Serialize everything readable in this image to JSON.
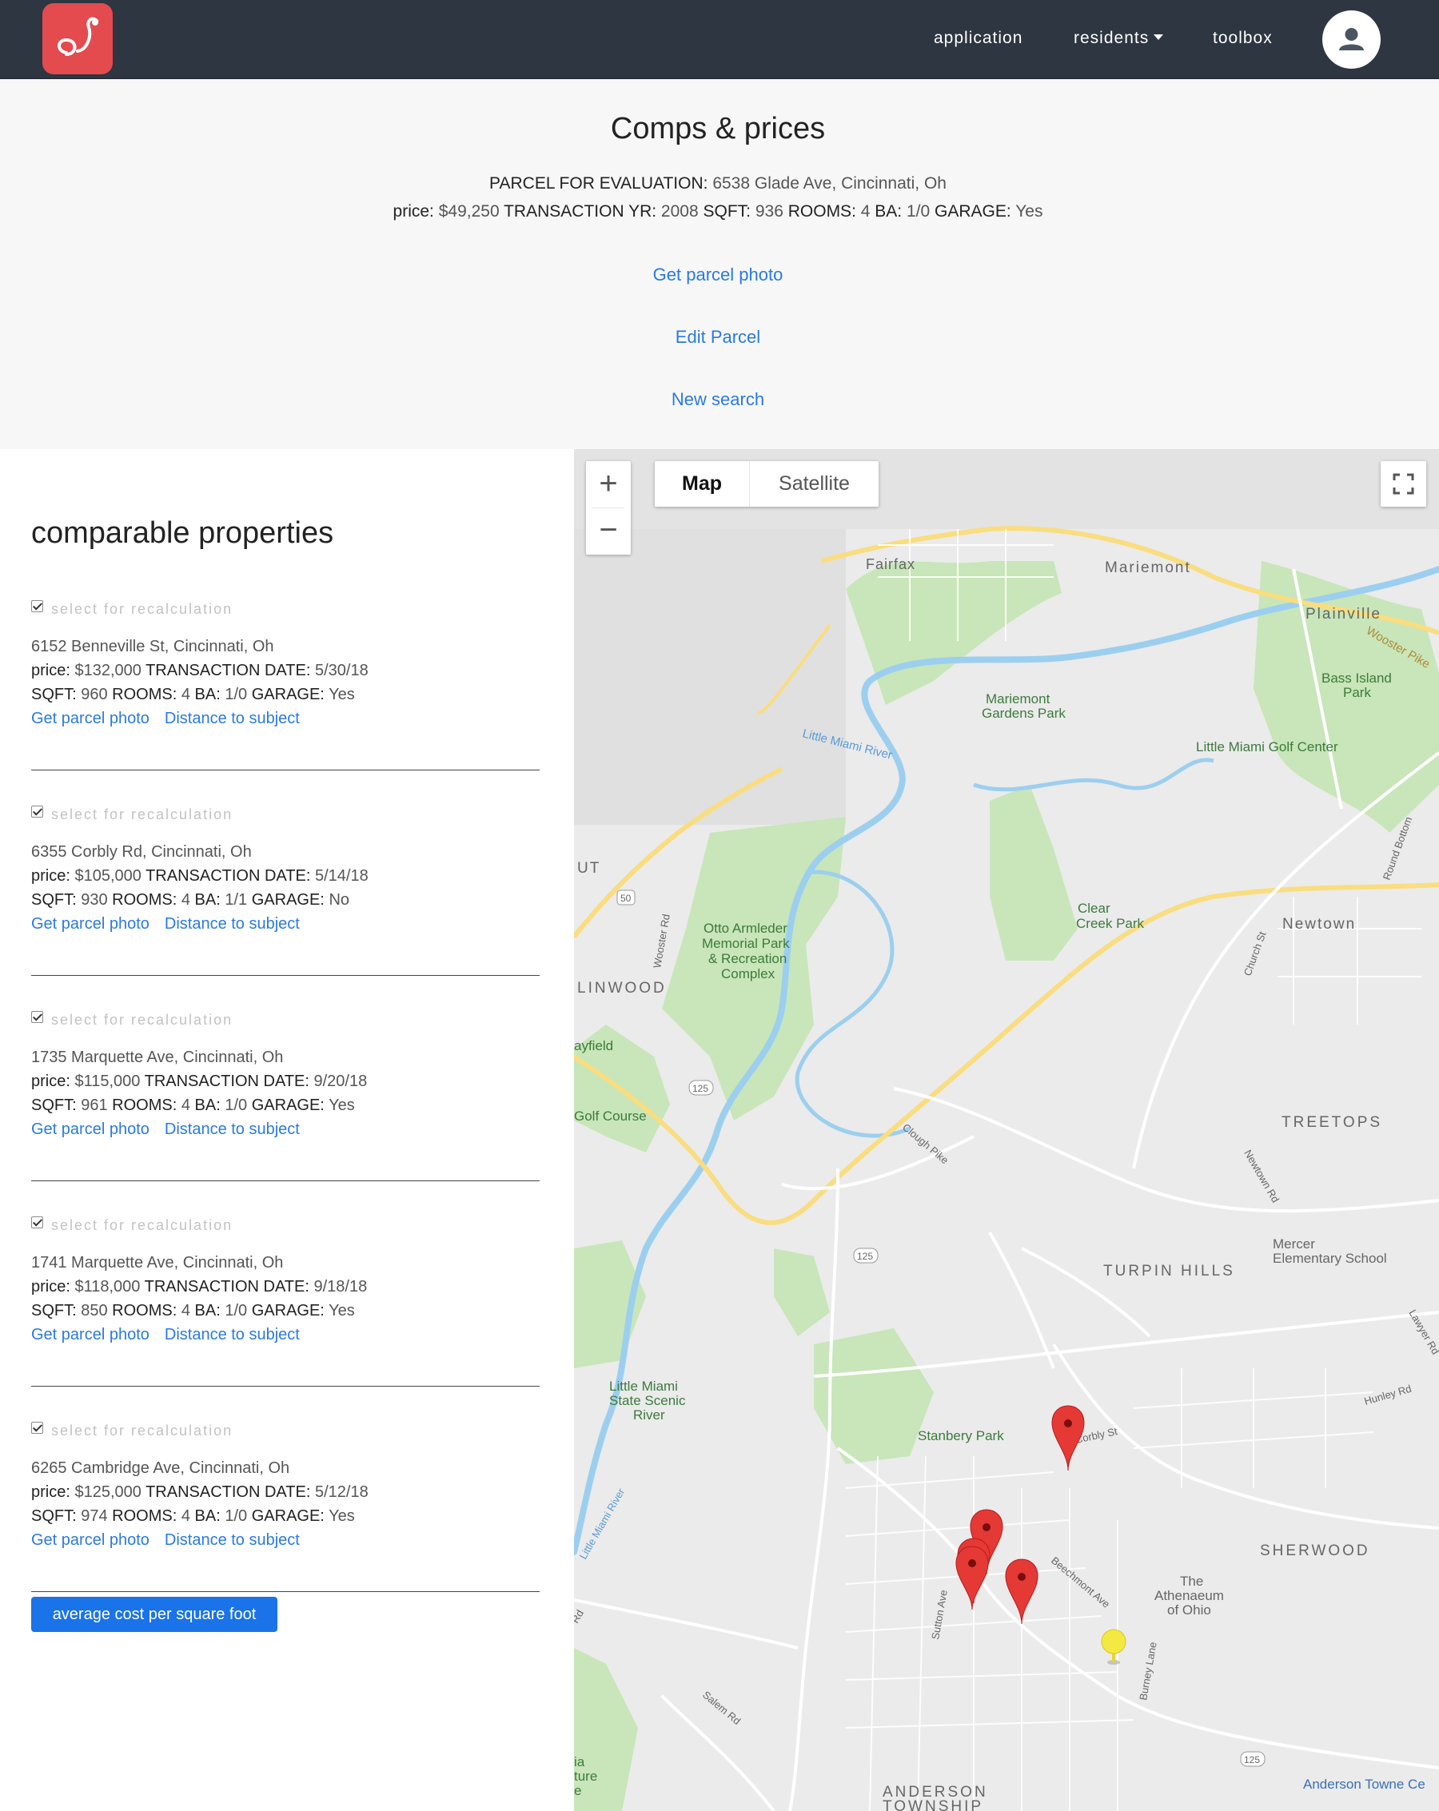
{
  "nav": {
    "items": [
      {
        "label": "application"
      },
      {
        "label": "residents"
      },
      {
        "label": "toolbox"
      }
    ]
  },
  "header": {
    "title": "Comps & prices",
    "parcel": {
      "eval_label": "PARCEL FOR EVALUATION:",
      "address": "6538 Glade Ave, Cincinnati, Oh",
      "price_label": "price:",
      "price": "$49,250",
      "year_label": "TRANSACTION YR:",
      "year": "2008",
      "sqft_label": "SQFT:",
      "sqft": "936",
      "rooms_label": "ROOMS:",
      "rooms": "4",
      "ba_label": "BA:",
      "ba": "1/0",
      "garage_label": "GARAGE:",
      "garage": "Yes"
    },
    "links": {
      "photo": "Get parcel photo",
      "edit": "Edit Parcel",
      "search": "New search"
    }
  },
  "comps": {
    "title": "comparable properties",
    "select_label": "select for recalculation",
    "labels": {
      "price": "price:",
      "date": "TRANSACTION DATE:",
      "sqft": "SQFT:",
      "rooms": "ROOMS:",
      "ba": "BA:",
      "garage": "GARAGE:"
    },
    "photo_link": "Get parcel photo",
    "distance_link": "Distance to subject",
    "items": [
      {
        "address": "6152 Benneville St, Cincinnati, Oh",
        "price": "$132,000",
        "date": "5/30/18",
        "sqft": "960",
        "rooms": "4",
        "ba": "1/0",
        "garage": "Yes"
      },
      {
        "address": "6355 Corbly Rd, Cincinnati, Oh",
        "price": "$105,000",
        "date": "5/14/18",
        "sqft": "930",
        "rooms": "4",
        "ba": "1/1",
        "garage": "No"
      },
      {
        "address": "1735 Marquette Ave, Cincinnati, Oh",
        "price": "$115,000",
        "date": "9/20/18",
        "sqft": "961",
        "rooms": "4",
        "ba": "1/0",
        "garage": "Yes"
      },
      {
        "address": "1741 Marquette Ave, Cincinnati, Oh",
        "price": "$118,000",
        "date": "9/18/18",
        "sqft": "850",
        "rooms": "4",
        "ba": "1/0",
        "garage": "Yes"
      },
      {
        "address": "6265 Cambridge Ave, Cincinnati, Oh",
        "price": "$125,000",
        "date": "5/12/18",
        "sqft": "974",
        "rooms": "4",
        "ba": "1/0",
        "garage": "Yes"
      }
    ],
    "avg_button": "average cost per square foot"
  },
  "map": {
    "zoom_in": "+",
    "zoom_out": "−",
    "type_map": "Map",
    "type_satellite": "Satellite",
    "colors": {
      "park": "#c8e6b9",
      "water": "#9ccfef",
      "highway": "#f9dd7f",
      "marker_comp": "#e53935",
      "marker_subject": "#f4e842"
    },
    "labels": {
      "fairfax": "Fairfax",
      "mariemont": "Mariemont",
      "plainville": "Plainville",
      "wooster_pike": "Wooster Pike",
      "bass_island": "Bass Island",
      "park_word": "Park",
      "mariemont_gardens": "Mariemont",
      "gardens_park": "Gardens Park",
      "little_miami_river": "Little Miami River",
      "little_miami_golf": "Little Miami Golf Center",
      "newtown_road": "Newtown",
      "ut": "UT",
      "rt50": "50",
      "wooster_rd": "Wooster Rd",
      "otto1": "Otto Armleder",
      "otto2": "Memorial Park",
      "otto3": "& Recreation",
      "otto4": "Complex",
      "linwood": "LINWOOD",
      "clear_creek1": "Clear",
      "clear_creek2": "Creek Park",
      "newtown": "Newtown",
      "church_st": "Church St",
      "round_bottom": "Round Bottom",
      "ayfield": "ayfield",
      "rt125a": "125",
      "golf_course": "Golf Course",
      "treetops": "TREETOPS",
      "clough_pike": "Clough Pike",
      "newtown_rd": "Newtown Rd",
      "mercer1": "Mercer",
      "mercer2": "Elementary School",
      "turpin_hills": "TURPIN HILLS",
      "lawyer_rd": "Lawyer Rd",
      "rt125b": "125",
      "lmsr1": "Little Miami",
      "lmsr2": "State Scenic",
      "lmsr3": "River",
      "hunley_rd": "Hunley Rd",
      "stanbery": "Stanbery Park",
      "corbly_st": "Corbly St",
      "sherwood": "SHERWOOD",
      "beechmont": "Beechmont Ave",
      "sutton": "Sutton Ave",
      "athenaeum1": "The",
      "athenaeum2": "Athenaeum",
      "athenaeum3": "of Ohio",
      "burney": "Burney Lane",
      "salem": "Salem Rd",
      "rt125c": "125",
      "anderson": "ANDERSON",
      "anderson2": "TOWNSHIP",
      "anderson_towne": "Anderson Towne Ce",
      "river_left": "Little Miami River",
      "rd_left": "Rd",
      "ia": "ia",
      "ture": "ture",
      "e": "e"
    }
  }
}
